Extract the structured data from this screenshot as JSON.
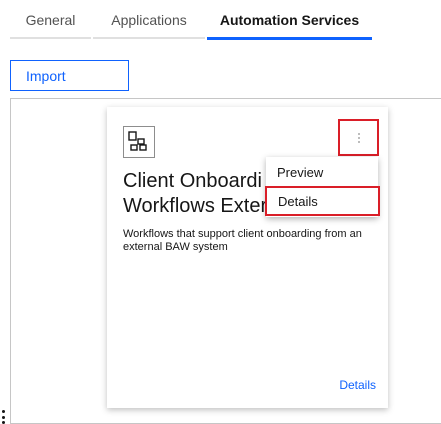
{
  "tabs": [
    {
      "label": "General",
      "active": false
    },
    {
      "label": "Applications",
      "active": false
    },
    {
      "label": "Automation Services",
      "active": true
    }
  ],
  "toolbar": {
    "import_label": "Import"
  },
  "card": {
    "icon": "app-grid-icon",
    "title_line1": "Client Onboardi",
    "title_line2": "Workflows Exter",
    "description": "Workflows that support client onboarding from an external BAW system",
    "details_link": "Details"
  },
  "overflow_menu": {
    "items": [
      {
        "label": "Preview",
        "highlighted": false
      },
      {
        "label": "Details",
        "highlighted": true
      }
    ]
  },
  "colors": {
    "accent": "#0f62fe",
    "highlight": "#da1e28",
    "text": "#161616"
  }
}
